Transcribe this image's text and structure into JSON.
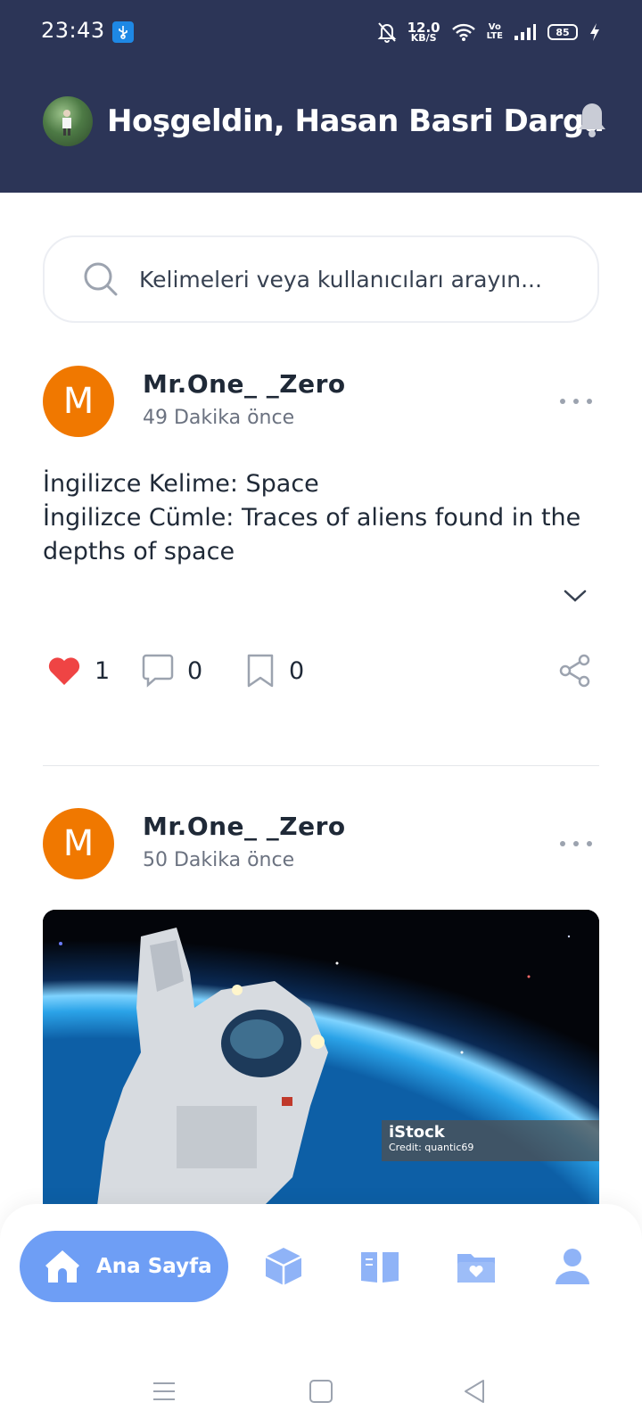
{
  "status_bar": {
    "time": "23:43",
    "network_speed": "12.0",
    "network_unit": "KB/S",
    "volte_top": "Vo",
    "volte_bottom": "LTE",
    "battery": "85"
  },
  "header": {
    "welcome": "Hoşgeldin, Hasan Basri Darga"
  },
  "search": {
    "placeholder": "Kelimeleri veya kullanıcıları arayın..."
  },
  "posts": [
    {
      "avatar_letter": "M",
      "username": "Mr.One_ _Zero",
      "time": "49 Dakika önce",
      "line1": "İngilizce Kelime: Space",
      "line2": "İngilizce Cümle: Traces of aliens found in the depths of space",
      "likes": "1",
      "comments": "0",
      "saves": "0"
    },
    {
      "avatar_letter": "M",
      "username": "Mr.One_ _Zero",
      "time": "50 Dakika önce",
      "image_brand": "iStock",
      "image_credit": "Credit: quantic69"
    }
  ],
  "bottom_nav": {
    "home_label": "Ana Sayfa"
  },
  "colors": {
    "header_bg": "#2c3557",
    "accent": "#6e9ef5",
    "avatar_orange": "#f07800",
    "like_red": "#ef4444"
  }
}
